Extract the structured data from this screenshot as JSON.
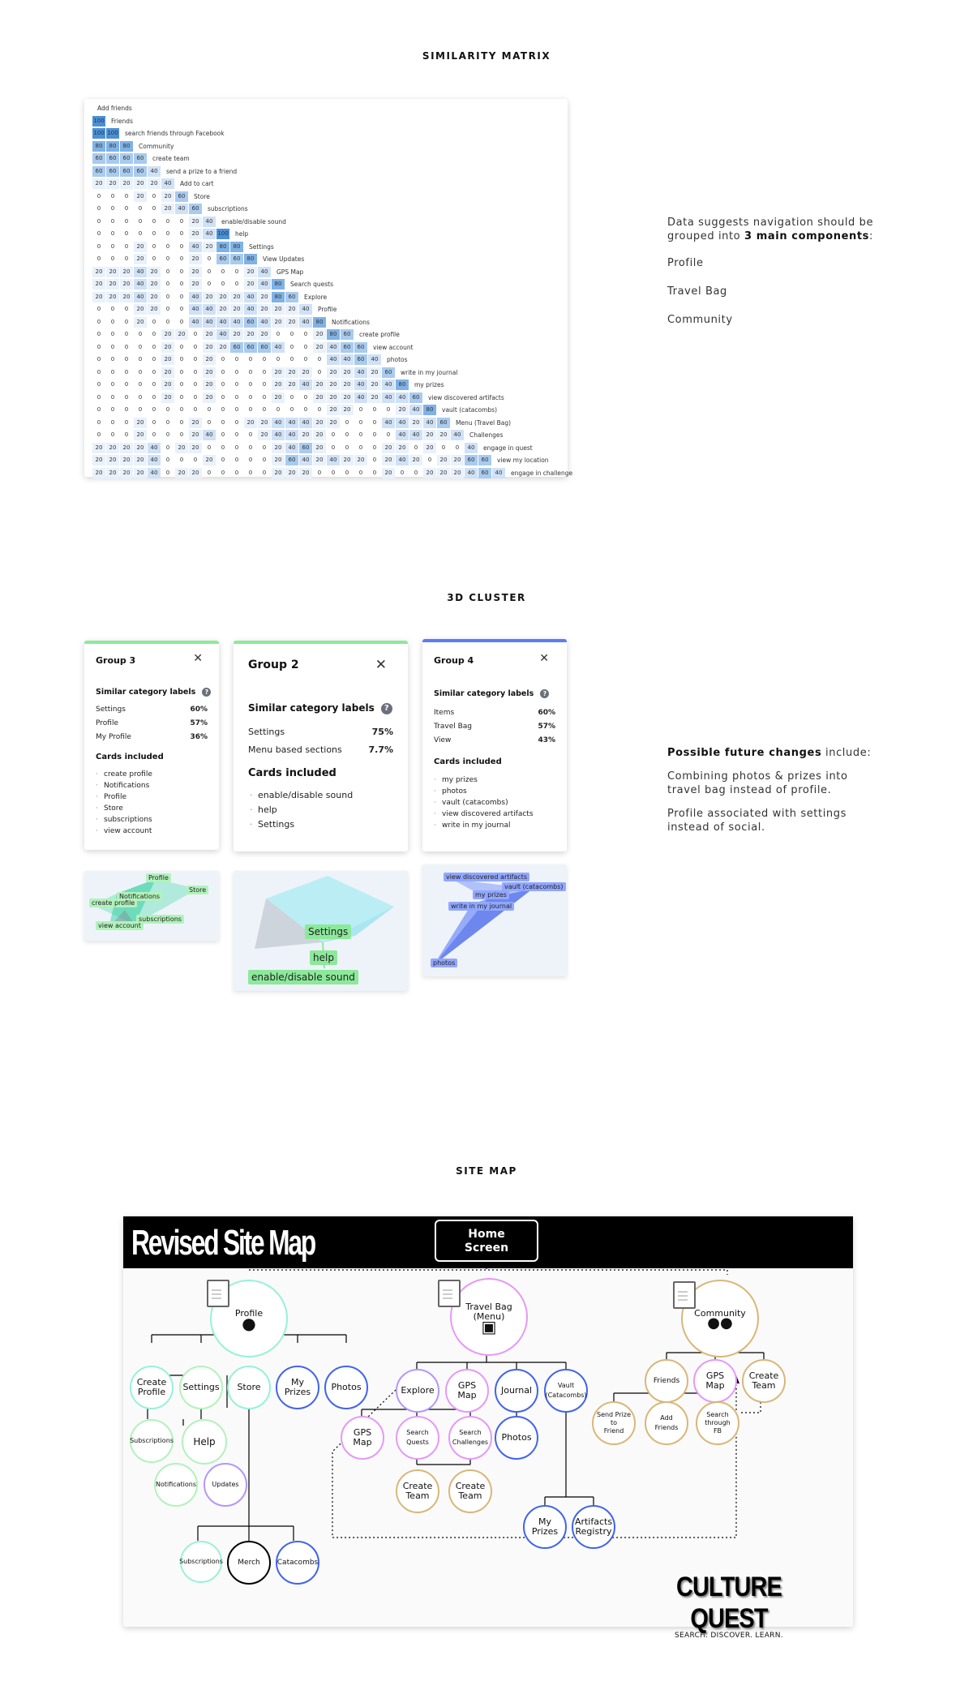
{
  "sections": {
    "similarity_title": "SIMILARITY MATRIX",
    "cluster_title": "3D CLUSTER",
    "sitemap_title": "SITE MAP"
  },
  "matrix": {
    "rows": [
      {
        "label": "Add friends",
        "values": []
      },
      {
        "label": "Friends",
        "values": [
          100
        ]
      },
      {
        "label": "search friends through Facebook",
        "values": [
          100,
          100
        ]
      },
      {
        "label": "Community",
        "values": [
          80,
          80,
          80
        ]
      },
      {
        "label": "create team",
        "values": [
          60,
          60,
          60,
          60
        ]
      },
      {
        "label": "send a prize to a friend",
        "values": [
          60,
          60,
          60,
          60,
          40
        ]
      },
      {
        "label": "Add to cart",
        "values": [
          20,
          20,
          20,
          20,
          20,
          40
        ]
      },
      {
        "label": "Store",
        "values": [
          0,
          0,
          0,
          20,
          0,
          20,
          60
        ]
      },
      {
        "label": "subscriptions",
        "values": [
          0,
          0,
          0,
          0,
          0,
          20,
          40,
          60
        ]
      },
      {
        "label": "enable/disable sound",
        "values": [
          0,
          0,
          0,
          0,
          0,
          0,
          0,
          20,
          40
        ]
      },
      {
        "label": "help",
        "values": [
          0,
          0,
          0,
          0,
          0,
          0,
          0,
          20,
          40,
          100
        ]
      },
      {
        "label": "Settings",
        "values": [
          0,
          0,
          0,
          20,
          0,
          0,
          0,
          40,
          20,
          80,
          80
        ]
      },
      {
        "label": "View Updates",
        "values": [
          0,
          0,
          0,
          20,
          0,
          0,
          0,
          20,
          0,
          60,
          60,
          80
        ]
      },
      {
        "label": "GPS Map",
        "values": [
          20,
          20,
          20,
          40,
          20,
          0,
          0,
          20,
          0,
          0,
          0,
          20,
          40
        ]
      },
      {
        "label": "Search quests",
        "values": [
          20,
          20,
          20,
          40,
          20,
          0,
          0,
          20,
          0,
          0,
          0,
          20,
          40,
          80
        ]
      },
      {
        "label": "Explore",
        "values": [
          20,
          20,
          20,
          40,
          20,
          0,
          0,
          40,
          20,
          20,
          20,
          40,
          20,
          80,
          60
        ]
      },
      {
        "label": "Profile",
        "values": [
          0,
          0,
          0,
          20,
          20,
          0,
          0,
          40,
          40,
          20,
          20,
          40,
          20,
          20,
          20,
          40
        ]
      },
      {
        "label": "Notifications",
        "values": [
          0,
          0,
          0,
          20,
          0,
          0,
          0,
          40,
          40,
          40,
          40,
          60,
          40,
          20,
          20,
          40,
          80
        ]
      },
      {
        "label": "create profile",
        "values": [
          0,
          0,
          0,
          0,
          0,
          20,
          20,
          0,
          20,
          40,
          20,
          20,
          20,
          0,
          0,
          0,
          20,
          80,
          60
        ]
      },
      {
        "label": "view account",
        "values": [
          0,
          0,
          0,
          0,
          0,
          20,
          0,
          0,
          20,
          20,
          60,
          60,
          60,
          40,
          0,
          0,
          20,
          40,
          60,
          60
        ]
      },
      {
        "label": "photos",
        "values": [
          0,
          0,
          0,
          0,
          0,
          20,
          0,
          0,
          20,
          0,
          0,
          0,
          0,
          0,
          0,
          0,
          0,
          40,
          40,
          60,
          40
        ]
      },
      {
        "label": "write in my journal",
        "values": [
          0,
          0,
          0,
          0,
          0,
          20,
          0,
          0,
          20,
          0,
          0,
          0,
          0,
          20,
          20,
          20,
          0,
          20,
          20,
          40,
          20,
          60
        ]
      },
      {
        "label": "my prizes",
        "values": [
          0,
          0,
          0,
          0,
          0,
          20,
          0,
          0,
          20,
          0,
          0,
          0,
          0,
          20,
          20,
          40,
          20,
          20,
          20,
          40,
          20,
          40,
          80
        ]
      },
      {
        "label": "view discovered artifacts",
        "values": [
          0,
          0,
          0,
          0,
          0,
          20,
          0,
          0,
          20,
          0,
          0,
          0,
          0,
          20,
          0,
          0,
          20,
          20,
          20,
          40,
          20,
          40,
          40,
          60
        ]
      },
      {
        "label": "vault (catacombs)",
        "values": [
          0,
          0,
          0,
          0,
          0,
          0,
          0,
          0,
          0,
          0,
          0,
          0,
          0,
          0,
          0,
          0,
          0,
          20,
          20,
          0,
          0,
          0,
          20,
          40,
          80
        ]
      },
      {
        "label": "Menu (Travel Bag)",
        "values": [
          0,
          0,
          0,
          20,
          0,
          0,
          0,
          20,
          0,
          0,
          0,
          20,
          20,
          40,
          40,
          40,
          20,
          20,
          0,
          0,
          0,
          40,
          40,
          20,
          40,
          60
        ]
      },
      {
        "label": "Challenges",
        "values": [
          0,
          0,
          0,
          20,
          0,
          0,
          0,
          20,
          40,
          0,
          0,
          0,
          20,
          40,
          40,
          20,
          20,
          0,
          0,
          0,
          0,
          0,
          40,
          40,
          20,
          20,
          40
        ]
      },
      {
        "label": "engage in quest",
        "values": [
          20,
          20,
          20,
          20,
          40,
          0,
          20,
          20,
          0,
          0,
          0,
          0,
          0,
          20,
          40,
          60,
          20,
          0,
          0,
          0,
          0,
          20,
          20,
          0,
          20,
          0,
          0,
          40
        ]
      },
      {
        "label": "view my location",
        "values": [
          20,
          20,
          20,
          20,
          40,
          0,
          0,
          0,
          20,
          0,
          0,
          0,
          0,
          20,
          60,
          40,
          20,
          40,
          20,
          20,
          0,
          20,
          40,
          20,
          0,
          20,
          20,
          60,
          60
        ]
      },
      {
        "label": "engage in challenge",
        "values": [
          20,
          20,
          20,
          20,
          40,
          0,
          20,
          20,
          0,
          0,
          0,
          0,
          0,
          20,
          20,
          20,
          0,
          0,
          0,
          0,
          0,
          20,
          0,
          0,
          20,
          20,
          20,
          40,
          60,
          40
        ]
      }
    ]
  },
  "notes1": {
    "line1a": "Data suggests navigation should be",
    "line1b_pre": "grouped into ",
    "line1b_bold": "3 main components",
    "line1b_post": ":",
    "items": [
      "Profile",
      "Travel Bag",
      "Community"
    ]
  },
  "groups": [
    {
      "title": "Group 3",
      "labels_heading": "Similar category labels",
      "labels": [
        {
          "name": "Settings",
          "pct": "60%"
        },
        {
          "name": "Profile",
          "pct": "57%"
        },
        {
          "name": "My Profile",
          "pct": "36%"
        }
      ],
      "cards_heading": "Cards included",
      "cards": [
        "create profile",
        "Notifications",
        "Profile",
        "Store",
        "subscriptions",
        "view account"
      ],
      "accent": "#8ce99a"
    },
    {
      "title": "Group 2",
      "labels_heading": "Similar category labels",
      "labels": [
        {
          "name": "Settings",
          "pct": "75%"
        },
        {
          "name": "Menu based sections",
          "pct": "7.7%"
        }
      ],
      "cards_heading": "Cards included",
      "cards": [
        "enable/disable sound",
        "help",
        "Settings"
      ],
      "accent": "#8ce99a"
    },
    {
      "title": "Group 4",
      "labels_heading": "Similar category labels",
      "labels": [
        {
          "name": "Items",
          "pct": "60%"
        },
        {
          "name": "Travel Bag",
          "pct": "57%"
        },
        {
          "name": "View",
          "pct": "43%"
        }
      ],
      "cards_heading": "Cards included",
      "cards": [
        "my prizes",
        "photos",
        "vault (catacombs)",
        "view discovered artifacts",
        "write in my journal"
      ],
      "accent": "#5c7cfa"
    }
  ],
  "viz_tags": {
    "g3": [
      "Profile",
      "Store",
      "Notifications",
      "create profile",
      "subscriptions",
      "view account"
    ],
    "g2": [
      "Settings",
      "help",
      "enable/disable sound"
    ],
    "g4": [
      "view discovered artifacts",
      "vault (catacombs)",
      "my prizes",
      "write in my journal",
      "photos"
    ]
  },
  "notes2": {
    "line1_bold": "Possible future changes",
    "line1_post": " include:",
    "p2a": "Combining photos & prizes into",
    "p2b": "travel bag instead of profile.",
    "p3a": "Profile associated with settings",
    "p3b": "instead of social."
  },
  "sitemap": {
    "title": "Revised Site Map",
    "home": [
      "Home",
      "Screen"
    ],
    "profile": "Profile",
    "travel_bag": [
      "Travel Bag",
      "(Menu)"
    ],
    "community": "Community",
    "nodes": {
      "create_profile": [
        "Create",
        "Profile"
      ],
      "settings": "Settings",
      "store": "Store",
      "my_prizes": [
        "My",
        "Prizes"
      ],
      "photos": "Photos",
      "subscriptions": "Subscriptions",
      "help": "Help",
      "notifications": "Notifications",
      "updates": "Updates",
      "subscriptions2": "Subscriptions",
      "merch": "Merch",
      "catacombs": "Catacombs",
      "explore": "Explore",
      "gps_map": [
        "GPS",
        "Map"
      ],
      "journal": "Journal",
      "vault": [
        "Vault",
        "(Catacombs)"
      ],
      "gps_map2": [
        "GPS",
        "Map"
      ],
      "search_quests": [
        "Search",
        "Quests"
      ],
      "search_challenges": [
        "Search",
        "Challenges"
      ],
      "photos2": "Photos",
      "create_team1": [
        "Create",
        "Team"
      ],
      "create_team2": [
        "Create",
        "Team"
      ],
      "my_prizes2": [
        "My",
        "Prizes"
      ],
      "artifacts_registry": [
        "Artifacts",
        "Registry"
      ],
      "friends": "Friends",
      "gps_map3": [
        "GPS",
        "Map"
      ],
      "create_team3": [
        "Create",
        "Team"
      ],
      "send_prize": [
        "Send Prize",
        "to",
        "Friend"
      ],
      "add_friends": [
        "Add",
        "Friends"
      ],
      "search_fb": [
        "Search",
        "through",
        "FB"
      ]
    },
    "logo_main": "CULTURE QUEST",
    "logo_sub": "SEARCH. DISCOVER. LEARN."
  },
  "colors": {
    "teal": "#96f2d7",
    "green": "#b2f2bb",
    "blue": "#4263eb",
    "pink": "#e599f7",
    "gold": "#d9b779",
    "lavender": "#b197fc"
  }
}
